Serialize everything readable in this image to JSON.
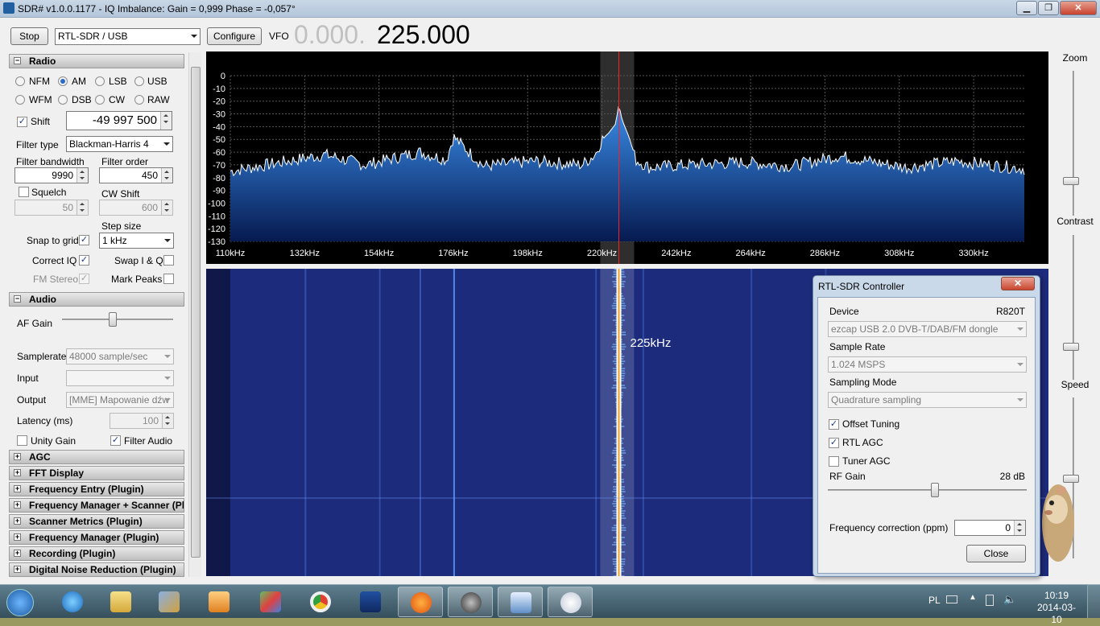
{
  "window": {
    "title": "SDR# v1.0.0.1177 - IQ Imbalance: Gain = 0,999 Phase = -0,057°",
    "min": "▁",
    "max": "❐",
    "close": "✕"
  },
  "toolbar": {
    "stop_label": "Stop",
    "source": "RTL-SDR / USB",
    "configure_label": "Configure",
    "vfo_label": "VFO",
    "vfo_dim": "0.000.",
    "vfo_main": "225.000"
  },
  "radio": {
    "header": "Radio",
    "modes": [
      "NFM",
      "AM",
      "LSB",
      "USB",
      "WFM",
      "DSB",
      "CW",
      "RAW"
    ],
    "selected_mode": "AM",
    "shift_label": "Shift",
    "shift_value": "-49 997 500",
    "filter_type_label": "Filter type",
    "filter_type": "Blackman-Harris 4",
    "filter_bw_label": "Filter bandwidth",
    "filter_bw": "9990",
    "filter_order_label": "Filter order",
    "filter_order": "450",
    "squelch_label": "Squelch",
    "squelch_value": "50",
    "cw_shift_label": "CW Shift",
    "cw_shift_value": "600",
    "step_size_label": "Step size",
    "step_size": "1 kHz",
    "snap_label": "Snap to grid",
    "correct_iq_label": "Correct IQ",
    "swap_iq_label": "Swap I & Q",
    "fm_stereo_label": "FM Stereo",
    "mark_peaks_label": "Mark Peaks"
  },
  "audio": {
    "header": "Audio",
    "af_gain_label": "AF Gain",
    "af_gain_level": 0.45,
    "samplerate_label": "Samplerate",
    "samplerate": "48000 sample/sec",
    "input_label": "Input",
    "input": "",
    "output_label": "Output",
    "output": "[MME] Mapowanie dźw",
    "latency_label": "Latency (ms)",
    "latency": "100",
    "unity_gain_label": "Unity Gain",
    "filter_audio_label": "Filter Audio"
  },
  "plugins": [
    "AGC",
    "FFT Display",
    "Frequency Entry (Plugin)",
    "Frequency Manager + Scanner (Plug",
    "Scanner Metrics (Plugin)",
    "Frequency Manager (Plugin)",
    "Recording (Plugin)",
    "Digital Noise Reduction (Plugin)"
  ],
  "chart_data": {
    "type": "line",
    "xlabel": "",
    "ylabel": "",
    "ylim": [
      -130,
      0
    ],
    "y_ticks": [
      "0",
      "-10",
      "-20",
      "-30",
      "-40",
      "-50",
      "-60",
      "-70",
      "-80",
      "-90",
      "-100",
      "-110",
      "-120",
      "-130"
    ],
    "x_ticks": [
      "110kHz",
      "132kHz",
      "154kHz",
      "176kHz",
      "198kHz",
      "220kHz",
      "242kHz",
      "264kHz",
      "286kHz",
      "308kHz",
      "330kHz"
    ],
    "xlim": [
      110,
      345
    ],
    "series": [
      {
        "x": [
          110,
          125,
          138,
          150,
          166,
          174,
          176,
          185,
          200,
          214,
          218,
          220,
          222,
          224,
          225,
          226,
          228,
          230,
          234,
          245,
          262,
          276,
          290,
          310,
          325,
          345
        ],
        "y": [
          -75,
          -68,
          -62,
          -70,
          -60,
          -66,
          -48,
          -71,
          -67,
          -70,
          -62,
          -50,
          -45,
          -38,
          -23,
          -35,
          -48,
          -66,
          -72,
          -70,
          -68,
          -71,
          -63,
          -72,
          -67,
          -73
        ]
      }
    ],
    "waterfall_marker": "225kHz"
  },
  "right": {
    "zoom_label": "Zoom",
    "contrast_label": "Contrast",
    "speed_label": "Speed"
  },
  "rtl": {
    "title": "RTL-SDR Controller",
    "close_x": "✕",
    "device_label": "Device",
    "device_model": "R820T",
    "device": "ezcap USB 2.0 DVB-T/DAB/FM dongle",
    "sample_rate_label": "Sample Rate",
    "sample_rate": "1.024 MSPS",
    "sampling_mode_label": "Sampling Mode",
    "sampling_mode": "Quadrature sampling",
    "offset_tuning_label": "Offset Tuning",
    "rtl_agc_label": "RTL AGC",
    "tuner_agc_label": "Tuner AGC",
    "rf_gain_label": "RF Gain",
    "rf_gain_value": "28 dB",
    "rf_gain_level": 0.54,
    "freq_corr_label": "Frequency correction (ppm)",
    "freq_corr": "0",
    "close_label": "Close"
  },
  "taskbar": {
    "lang": "PL",
    "time": "10:19",
    "date": "2014-03-10"
  },
  "colors": {
    "spectrum_fill": "#1e6ad8",
    "waterfall_bg": "#1d2b7c",
    "marker": "#ff2020"
  }
}
